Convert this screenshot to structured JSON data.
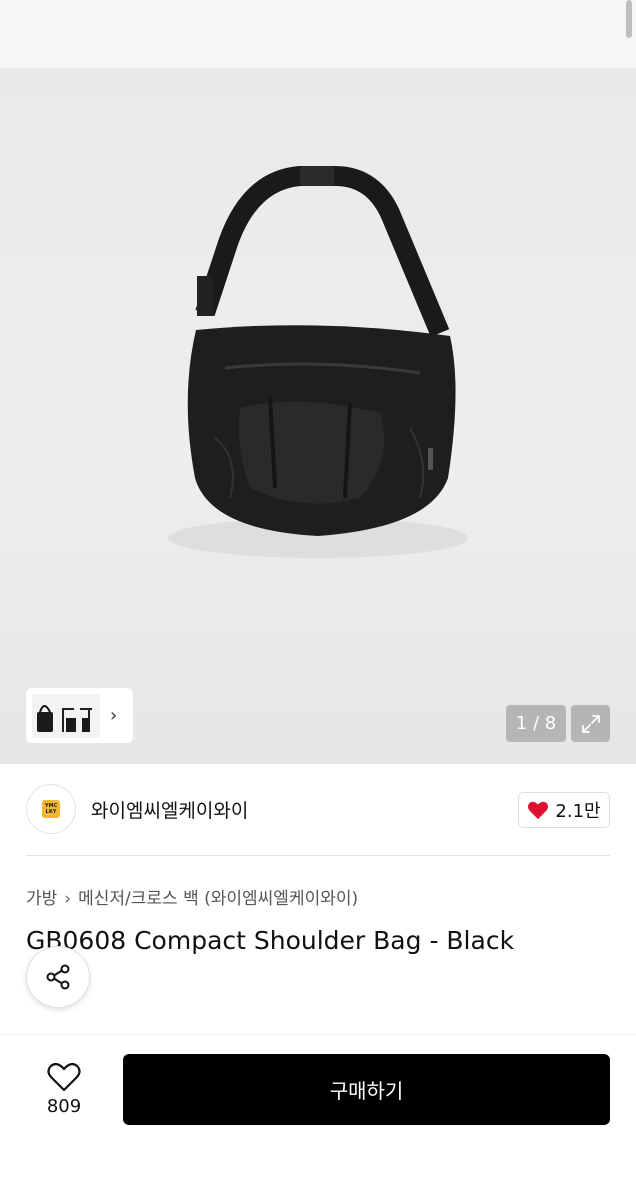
{
  "gallery": {
    "counter": "1 / 8",
    "expand_icon": "expand-arrows-icon",
    "image_alt": "black compact shoulder bag"
  },
  "brand": {
    "logo_text": "YMC LKY",
    "name": "와이엠씨엘케이와이",
    "like_count": "2.1만",
    "like_color": "#e0102e"
  },
  "breadcrumb": {
    "category": "가방",
    "subcategory": "메신저/크로스 백 (와이엠씨엘케이와이)"
  },
  "product": {
    "title": "GB0608 Compact Shoulder Bag - Black"
  },
  "bottom_bar": {
    "wish_count": "809",
    "buy_label": "구매하기"
  }
}
